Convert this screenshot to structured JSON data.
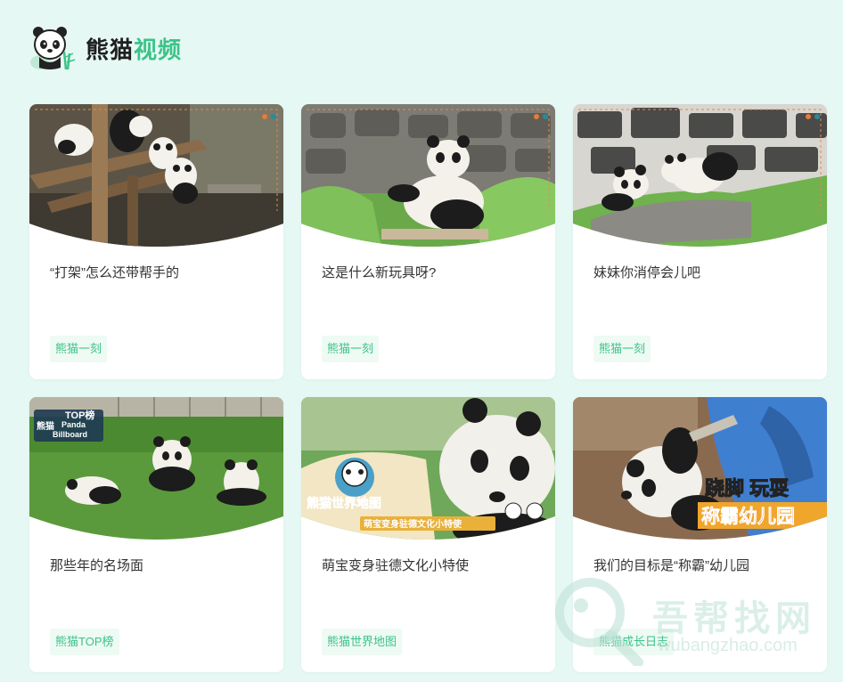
{
  "header": {
    "brand_part1": "熊猫",
    "brand_part2": "视频"
  },
  "colors": {
    "accent": "#3cc389",
    "page_bg": "#e6f8f3",
    "tag_bg": "#eefaf4"
  },
  "videos": [
    {
      "title": "“打架”怎么还带帮手的",
      "tag": "熊猫一刻",
      "thumb_icon": "pandas-climbing-log-photo"
    },
    {
      "title": "这是什么新玩具呀?",
      "tag": "熊猫一刻",
      "thumb_icon": "panda-sitting-grass-photo"
    },
    {
      "title": "妹妹你消停会儿吧",
      "tag": "熊猫一刻",
      "thumb_icon": "two-pandas-on-rock-photo"
    },
    {
      "title": "那些年的名场面",
      "tag": "熊猫TOP榜",
      "thumb_icon": "three-pandas-lawn-photo",
      "overlay": [
        "TOP榜",
        "熊猫",
        "Panda",
        "Billboard"
      ]
    },
    {
      "title": "萌宝变身驻德文化小特使",
      "tag": "熊猫世界地图",
      "thumb_icon": "panda-world-map-photo",
      "overlay": [
        "熊猫世界地图",
        "萌宝变身驻德文化小特使"
      ]
    },
    {
      "title": "我们的目标是“称霸”幼儿园",
      "tag": "熊猫成长日志",
      "thumb_icon": "keeper-with-panda-photo",
      "overlay": [
        "跷脚 玩耍",
        "称霸幼儿园"
      ]
    }
  ],
  "watermark": {
    "text": "吾帮找网",
    "url": "wubangzhao.com"
  }
}
